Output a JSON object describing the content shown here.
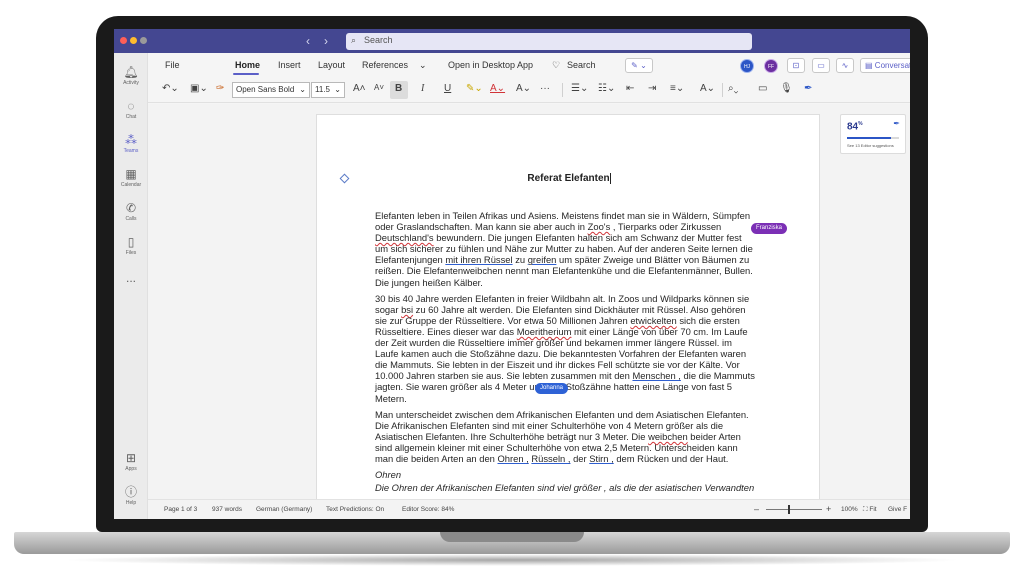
{
  "window": {
    "search_placeholder": "Search"
  },
  "rail": {
    "items": [
      {
        "label": "Activity",
        "icon": "bell-icon"
      },
      {
        "label": "Chat",
        "icon": "chat-icon"
      },
      {
        "label": "Teams",
        "icon": "teams-icon"
      },
      {
        "label": "Calendar",
        "icon": "calendar-icon"
      },
      {
        "label": "Calls",
        "icon": "phone-icon"
      },
      {
        "label": "Files",
        "icon": "file-icon"
      },
      {
        "label": "...",
        "icon": "more-icon"
      }
    ],
    "apps_label": "Apps",
    "help_label": "Help"
  },
  "menu": {
    "tabs": [
      "File",
      "Home",
      "Insert",
      "Layout",
      "References"
    ],
    "open_desktop": "Open in Desktop App",
    "search_label": "Search",
    "conversation_label": "Conversation",
    "avatars": [
      {
        "initials": "HJ",
        "color": "#2b55c6"
      },
      {
        "initials": "FF",
        "color": "#6b2fa0"
      }
    ]
  },
  "ribbon": {
    "font_name": "Open Sans Bold",
    "font_size": "11.5"
  },
  "document": {
    "title": "Referat Elefanten",
    "paragraphs": {
      "p1_a": "Elefanten leben in Teilen Afrikas und Asiens. Meistens findet man sie in Wäldern, Sümpfen oder Graslandschaften. Man kann sie aber auch in ",
      "p1_zoos": "Zoo's",
      "p1_b": " , Tierparks oder Zirkussen ",
      "p1_deutschland": "Deutschland's",
      "p1_c": " bewundern. Die jungen Elefanten halten sich am Schwanz der Mutter fest um sich sicherer zu fühlen und Nähe zur Mutter zu haben. Auf der anderen Seite lernen die Elefantenjungen ",
      "p1_mit": "mit ihren Rüssel",
      "p1_d": " zu ",
      "p1_greifen": "greifen",
      "p1_e": " um später Zweige und Blätter von Bäumen zu reißen. Die Elefantenweibchen nennt man Elefantenkühe und die Elefantenmänner, Bullen. Die jungen heißen Kälber.",
      "p2_a": "30 bis 40 Jahre werden Elefanten in freier Wildbahn alt. In Zoos und Wildparks können sie sogar ",
      "p2_bsi": "bsi",
      "p2_b": " zu 60 Jahre alt werden. Die Elefanten sind Dickhäuter mit Rüssel. Also gehören sie zur Gruppe der Rüsseltiere. Vor etwa 50 Millionen Jahren ",
      "p2_etw": "etwickelten",
      "p2_c": " sich die ersten Rüsseltiere. Eines dieser war das ",
      "p2_moer": "Moeritherium",
      "p2_d": " mit einer Länge von über 70 cm. Im Laufe der Zeit wurden die Rüsseltiere immer größer und bekamen immer längere Rüssel. im Laufe kamen auch die Stoßzähne dazu. Die bekanntesten Vorfahren der Elefanten waren die Mammuts. Sie lebten in der Eiszeit und ihr dickes Fell schützte sie vor der Kälte. Vor 10.000 Jahren starben sie aus. Sie lebten zusammen mit den ",
      "p2_men": "Menschen ,",
      "p2_e": " die die Mammuts jagten. Sie waren größer als 4 Meter und ihre Stoßzähne hatten eine Länge von fast 5 Metern.",
      "p3_a": "Man unterscheidet zwischen dem Afrikanischen Elefanten und dem Asiatischen Elefanten. Die Afrikanischen Elefanten sind mit einer Schulterhöhe von 4 Metern größer als die Asiatischen Elefanten. Ihre Schulterhöhe beträgt nur 3 Meter. Die ",
      "p3_weib": "weibchen",
      "p3_b": " beider Arten sind allgemein kleiner mit einer Schulterhöhe von etwa 2,5 Metern. Unterscheiden kann man die beiden Arten an den ",
      "p3_ohren": "Ohren ,",
      "p3_c": " ",
      "p3_russel": "Rüsseln ,",
      "p3_d": " der ",
      "p3_stirn": "Stirn ,",
      "p3_e": " dem Rücken und der Haut.",
      "heading": "Ohren",
      "p4": "Die Ohren der Afrikanischen Elefanten sind viel größer , als die der asiatischen Verwandten"
    },
    "collaborators": [
      {
        "name": "Franziska",
        "color": "#7b2fb5"
      },
      {
        "name": "Johanna",
        "color": "#2e62d6"
      }
    ]
  },
  "editor": {
    "score": "84",
    "score_unit": "%",
    "score_fraction": 0.84,
    "suggestions": "See 13 Editor suggestions"
  },
  "status": {
    "page": "Page 1 of 3",
    "words": "937 words",
    "language": "German (Germany)",
    "predictions": "Text Predictions: On",
    "editor_score": "Editor Score: 84%",
    "minus": "–",
    "plus": "+",
    "zoom": "100%",
    "fit": "Fit",
    "feedback": "Give F"
  }
}
